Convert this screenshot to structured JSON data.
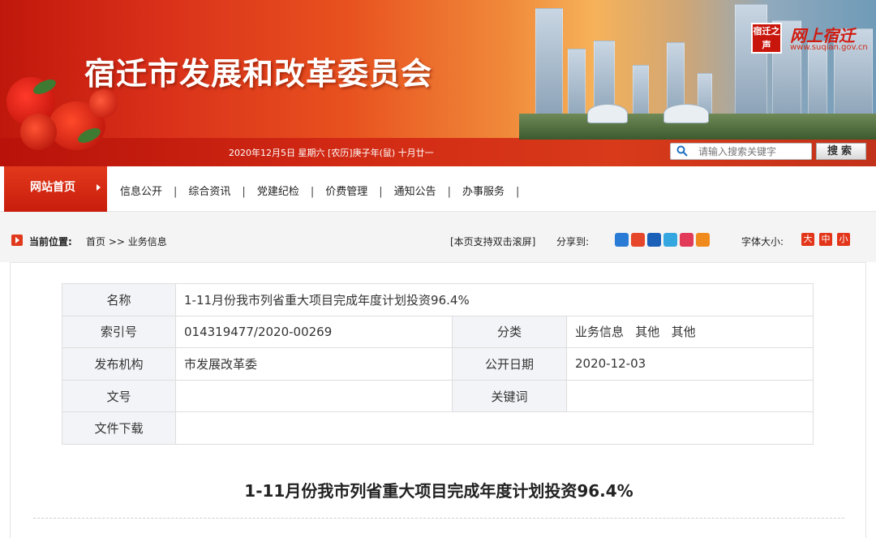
{
  "banner": {
    "site_title": "宿迁市发展和改革委员会",
    "date_text": "2020年12月5日 星期六 [农历]庚子年(鼠) 十月廿一",
    "logo_badge": "宿迁之声",
    "logo_text": "网上宿迁",
    "logo_url": "www.suqian.gov.cn",
    "search_placeholder": "请输入搜索关键字",
    "search_button": "搜索",
    "colors": {
      "brand_red": "#c8160c",
      "nav_red": "#e2391c"
    }
  },
  "nav": {
    "home": "网站首页",
    "items": [
      {
        "label": "信息公开"
      },
      {
        "label": "综合资讯"
      },
      {
        "label": "党建纪检"
      },
      {
        "label": "价费管理"
      },
      {
        "label": "通知公告"
      },
      {
        "label": "办事服务"
      }
    ],
    "separator": "|"
  },
  "location": {
    "label": "当前位置:",
    "path": "首页 >> 业务信息",
    "double_click_hint": "[本页支持双击滚屏]",
    "share_label": "分享到:",
    "share_icons": [
      "qzone-icon",
      "weibo-icon",
      "renren-icon",
      "tencent-weibo-icon",
      "kaixin-icon",
      "more-share-icon"
    ],
    "font_size_label": "字体大小:",
    "font_sizes": [
      "大",
      "中",
      "小"
    ]
  },
  "meta": {
    "name_label": "名称",
    "name_value": "1-11月份我市列省重大项目完成年度计划投资96.4%",
    "index_label": "索引号",
    "index_value": "014319477/2020-00269",
    "category_label": "分类",
    "category_value": "业务信息   其他   其他",
    "publisher_label": "发布机构",
    "publisher_value": "市发展改革委",
    "date_label": "公开日期",
    "date_value": "2020-12-03",
    "docno_label": "文号",
    "docno_value": "",
    "keyword_label": "关键词",
    "keyword_value": "",
    "download_label": "文件下载",
    "download_value": ""
  },
  "article": {
    "title": "1-11月份我市列省重大项目完成年度计划投资96.4%"
  }
}
